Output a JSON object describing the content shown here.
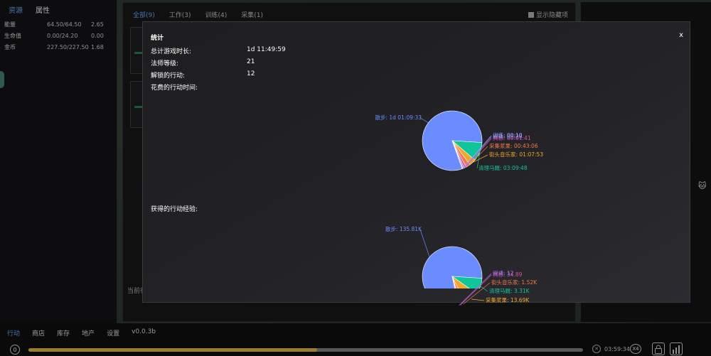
{
  "left_panel": {
    "tabs": [
      "资源",
      "属性"
    ],
    "resources": [
      {
        "name": "能量",
        "value": "64.50/64.50",
        "rate": "2.65"
      },
      {
        "name": "生命值",
        "value": "0.00/24.20",
        "rate": "0.00"
      },
      {
        "name": "金币",
        "value": "227.50/227.50",
        "rate": "1.68"
      }
    ]
  },
  "mid_panel": {
    "tabs": [
      "全部(9)",
      "工作(3)",
      "训练(4)",
      "采集(1)"
    ],
    "show_hidden": "显示隐藏项",
    "status": "当前行"
  },
  "bottom": {
    "nav": [
      "行动",
      "商店",
      "库存",
      "地产",
      "设置"
    ],
    "version": "v0.0.3b",
    "badge": "0",
    "progress": 0.52,
    "time": "03:59:34",
    "speed": "X4"
  },
  "stats_modal": {
    "title": "统计",
    "close": "x",
    "rows": [
      {
        "label": "总计游戏时长:",
        "value": "1d 11:49:59"
      },
      {
        "label": "法师等级:",
        "value": "21"
      },
      {
        "label": "解锁的行动:",
        "value": "12"
      }
    ],
    "time_spent_label": "花费的行动时间:",
    "exp_label": "获得的行动经验:"
  },
  "chart_data": [
    {
      "type": "pie",
      "title": "花费的行动时间:",
      "slices": [
        {
          "label": "散步: 1d 01:09:33",
          "value": 90573,
          "color": "#6b8cff"
        },
        {
          "label": "清理马厩: 03:09:48",
          "value": 11388,
          "color": "#12c49a"
        },
        {
          "label": "街头音乐家: 01:07:53",
          "value": 4073,
          "color": "#f3a72a"
        },
        {
          "label": "采集浆果: 00:43:06",
          "value": 2586,
          "color": "#f07a4a"
        },
        {
          "label": "冥想: 00:01:41",
          "value": 1300,
          "color": "#e050a0"
        },
        {
          "label": "阅读: 00:20",
          "value": 800,
          "color": "#a070ff"
        },
        {
          "label": "训练: 00:10",
          "value": 500,
          "color": "#8fb0ff"
        }
      ]
    },
    {
      "type": "pie",
      "title": "获得的行动经验:",
      "slices": [
        {
          "label": "散步: 135.81K",
          "value": 135810,
          "color": "#6b8cff"
        },
        {
          "label": "清理马厩: 3.31K",
          "value": 15000,
          "color": "#12c49a"
        },
        {
          "label": "采集浆果: 13.69K",
          "value": 13690,
          "color": "#f3a72a"
        },
        {
          "label": "街头音乐家: 1.52K",
          "value": 4000,
          "color": "#f07a4a"
        },
        {
          "label": "冥想: 34.89",
          "value": 1500,
          "color": "#e050a0"
        },
        {
          "label": "阅读: 12",
          "value": 900,
          "color": "#a070ff"
        }
      ]
    }
  ]
}
